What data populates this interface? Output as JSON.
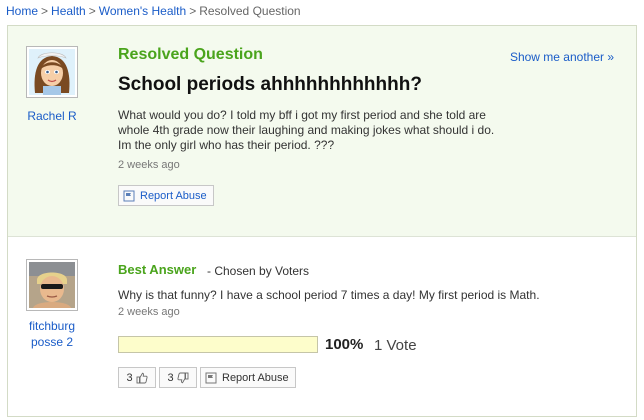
{
  "breadcrumb": {
    "items": [
      "Home",
      "Health",
      "Women's Health"
    ],
    "current": "Resolved Question",
    "separator": ">"
  },
  "question": {
    "section_label": "Resolved Question",
    "show_another": "Show me another »",
    "asker": "Rachel R",
    "title": "School periods ahhhhhhhhhhhh?",
    "body": "What would you do? I told my bff i got my first period and she told are whole 4th grade now their laughing and making jokes what should i do. Im the only girl who has their period. ???",
    "timestamp": "2 weeks ago",
    "report_label": "Report Abuse"
  },
  "answer": {
    "section_label": "Best Answer",
    "chosen_by": "- Chosen by Voters",
    "answerer": "fitchburg posse 2",
    "body": "Why is that funny? I have a school period 7 times a day! My first period is Math.",
    "timestamp": "2 weeks ago",
    "vote_fraction": 1.0,
    "vote_percent": "100%",
    "vote_count": "1 Vote",
    "thumbs_up_count": "3",
    "thumbs_down_count": "3",
    "report_label": "Report Abuse"
  },
  "icons": {
    "report": "flag-icon",
    "thumbs_up": "thumbs-up-icon",
    "thumbs_down": "thumbs-down-icon"
  },
  "colors": {
    "link": "#1a5cc8",
    "section_green": "#4aa41c",
    "question_bg": "#f4faee",
    "vote_fill": "#fdfdcb"
  }
}
